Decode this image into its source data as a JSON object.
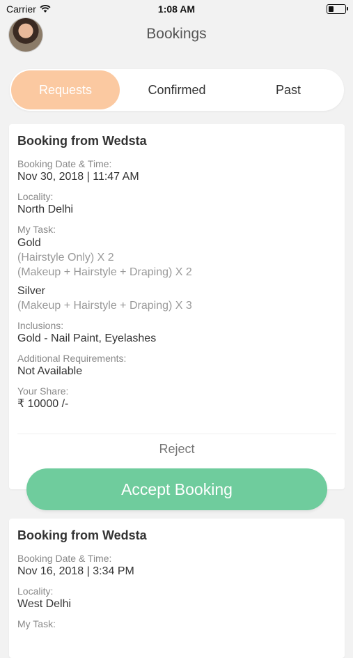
{
  "status_bar": {
    "carrier": "Carrier",
    "time": "1:08 AM"
  },
  "header": {
    "title": "Bookings"
  },
  "tabs": [
    {
      "label": "Requests",
      "active": true
    },
    {
      "label": "Confirmed",
      "active": false
    },
    {
      "label": "Past",
      "active": false
    }
  ],
  "bookings": [
    {
      "title": "Booking from Wedsta",
      "date_label": "Booking Date & Time:",
      "date_value": "Nov 30, 2018 | 11:47 AM",
      "locality_label": "Locality:",
      "locality_value": "North Delhi",
      "task_label": "My Task:",
      "tasks": [
        {
          "package": "Gold",
          "items": [
            "(Hairstyle Only) X 2",
            "(Makeup + Hairstyle + Draping) X 2"
          ]
        },
        {
          "package": "Silver",
          "items": [
            "(Makeup + Hairstyle + Draping) X 3"
          ]
        }
      ],
      "inclusions_label": "Inclusions:",
      "inclusions_value": "Gold - Nail Paint, Eyelashes",
      "requirements_label": "Additional Requirements:",
      "requirements_value": "Not Available",
      "share_label": "Your Share:",
      "share_value": "₹ 10000 /-",
      "reject_label": "Reject",
      "accept_label": "Accept Booking"
    },
    {
      "title": "Booking from Wedsta",
      "date_label": "Booking Date & Time:",
      "date_value": "Nov 16, 2018 | 3:34 PM",
      "locality_label": "Locality:",
      "locality_value": "West Delhi",
      "task_label": "My Task:"
    }
  ],
  "colors": {
    "active_tab": "#fbc9a1",
    "accept": "#6fcc9d",
    "background": "#f2f2f2"
  }
}
